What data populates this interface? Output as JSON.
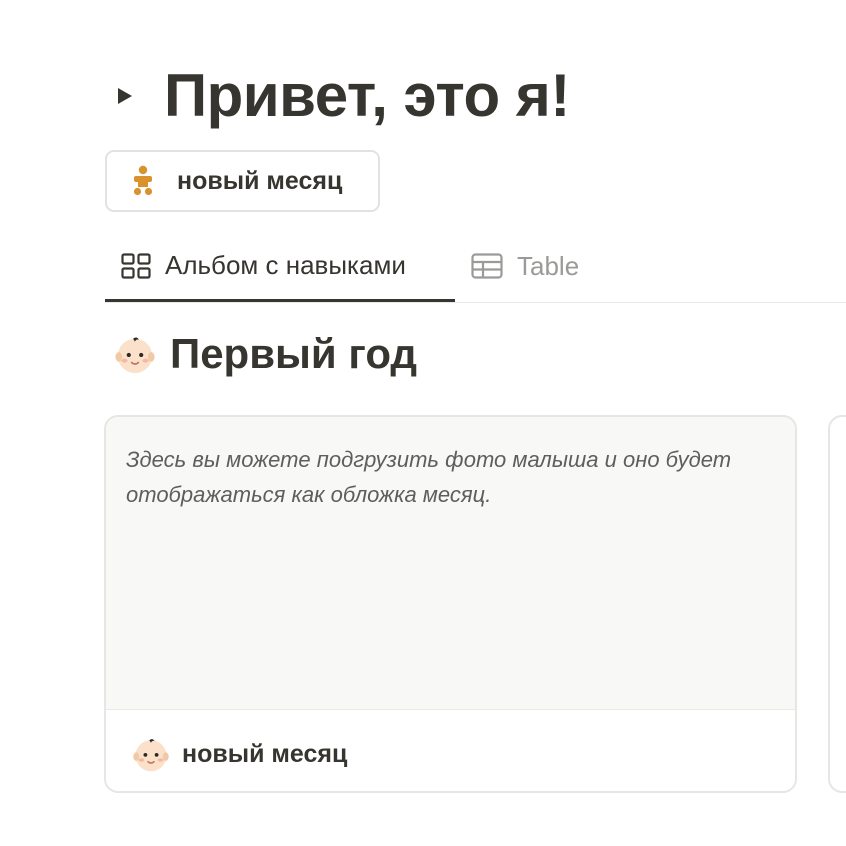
{
  "page": {
    "title": "Привет, это я!"
  },
  "new_button": {
    "label": "новый месяц",
    "icon": "baby-icon"
  },
  "tabs": [
    {
      "label": "Альбом с навыками",
      "icon": "gallery-icon",
      "active": true
    },
    {
      "label": "Table",
      "icon": "table-icon",
      "active": false
    }
  ],
  "group": {
    "title": "Первый год",
    "icon": "baby-face-icon"
  },
  "card": {
    "cover_text": "Здесь вы можете подгрузить фото малыша и оно будет отображаться как обложка месяц.",
    "title": "новый месяц",
    "icon": "baby-face-icon"
  },
  "colors": {
    "text": "#37352f",
    "muted": "#9b9a97",
    "cover_bg": "#f8f8f7",
    "border": "#e3e2e0",
    "baby_icon": "#d9922e"
  }
}
